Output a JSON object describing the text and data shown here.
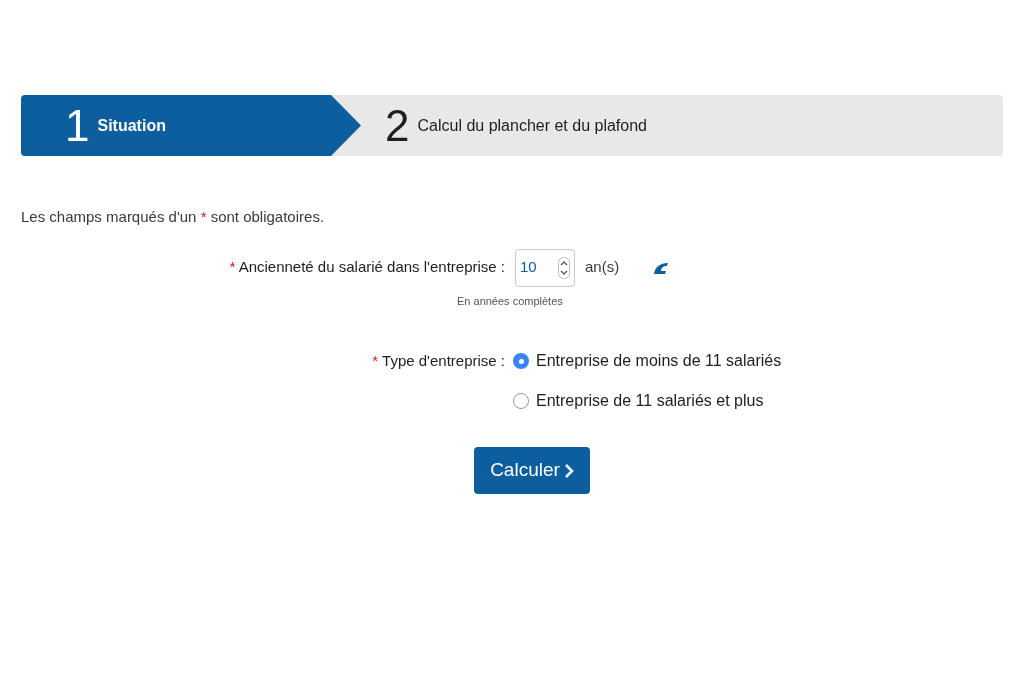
{
  "steps": [
    {
      "number": "1",
      "label": "Situation",
      "selected": true
    },
    {
      "number": "2",
      "label": "Calcul du plancher et du plafond",
      "selected": false
    }
  ],
  "notice": {
    "before": "Les champs marqués d'un ",
    "mark": "*",
    "after": " sont obligatoires."
  },
  "seniority": {
    "required_mark": "*",
    "label": "Ancienneté du salarié dans l'entreprise :",
    "value": "10",
    "unit": "an(s)",
    "hint": "En années complètes"
  },
  "company_type": {
    "required_mark": "*",
    "label": "Type d'entreprise :",
    "options": [
      {
        "label": "Entreprise de moins de 11 salariés",
        "selected": true
      },
      {
        "label": "Entreprise de 11 salariés et plus",
        "selected": false
      }
    ]
  },
  "submit": {
    "label": "Calculer"
  }
}
